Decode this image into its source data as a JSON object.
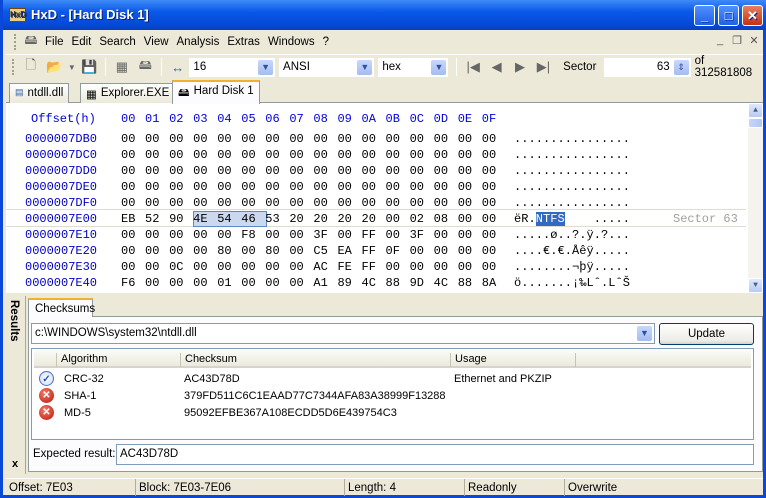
{
  "window": {
    "title": "HxD - [Hard Disk 1]"
  },
  "menu": [
    "File",
    "Edit",
    "Search",
    "View",
    "Analysis",
    "Extras",
    "Windows",
    "?"
  ],
  "toolbar": {
    "bytes_per_row": "16",
    "charset": "ANSI",
    "offset_base": "hex",
    "sector_label": "Sector",
    "sector_value": "63",
    "sector_total": "of 312581808"
  },
  "tabs": [
    {
      "label": "ntdll.dll",
      "icon": "dll-file-icon"
    },
    {
      "label": "Explorer.EXE",
      "icon": "memory-chip-icon"
    },
    {
      "label": "Hard Disk 1",
      "icon": "hard-disk-icon",
      "active": true
    }
  ],
  "hex": {
    "offset_header": "Offset(h)",
    "columns": [
      "00",
      "01",
      "02",
      "03",
      "04",
      "05",
      "06",
      "07",
      "08",
      "09",
      "0A",
      "0B",
      "0C",
      "0D",
      "0E",
      "0F"
    ],
    "rows": [
      {
        "offset": "0000007DB0",
        "bytes": [
          "00",
          "00",
          "00",
          "00",
          "00",
          "00",
          "00",
          "00",
          "00",
          "00",
          "00",
          "00",
          "00",
          "00",
          "00",
          "00"
        ],
        "text": "................"
      },
      {
        "offset": "0000007DC0",
        "bytes": [
          "00",
          "00",
          "00",
          "00",
          "00",
          "00",
          "00",
          "00",
          "00",
          "00",
          "00",
          "00",
          "00",
          "00",
          "00",
          "00"
        ],
        "text": "................"
      },
      {
        "offset": "0000007DD0",
        "bytes": [
          "00",
          "00",
          "00",
          "00",
          "00",
          "00",
          "00",
          "00",
          "00",
          "00",
          "00",
          "00",
          "00",
          "00",
          "00",
          "00"
        ],
        "text": "................"
      },
      {
        "offset": "0000007DE0",
        "bytes": [
          "00",
          "00",
          "00",
          "00",
          "00",
          "00",
          "00",
          "00",
          "00",
          "00",
          "00",
          "00",
          "00",
          "00",
          "00",
          "00"
        ],
        "text": "................"
      },
      {
        "offset": "0000007DF0",
        "bytes": [
          "00",
          "00",
          "00",
          "00",
          "00",
          "00",
          "00",
          "00",
          "00",
          "00",
          "00",
          "00",
          "00",
          "00",
          "00",
          "00"
        ],
        "text": "................"
      },
      {
        "offset": "0000007E00",
        "bytes": [
          "EB",
          "52",
          "90",
          "4E",
          "54",
          "46",
          "53",
          "20",
          "20",
          "20",
          "20",
          "00",
          "02",
          "08",
          "00",
          "00"
        ],
        "text_pre": "ëR.",
        "text_sel": "NTFS",
        "text_post": "    .....",
        "sector_marker": "Sector 63"
      },
      {
        "offset": "0000007E10",
        "bytes": [
          "00",
          "00",
          "00",
          "00",
          "00",
          "F8",
          "00",
          "00",
          "3F",
          "00",
          "FF",
          "00",
          "3F",
          "00",
          "00",
          "00"
        ],
        "text": ".....ø..?.ÿ.?..."
      },
      {
        "offset": "0000007E20",
        "bytes": [
          "00",
          "00",
          "00",
          "00",
          "80",
          "00",
          "80",
          "00",
          "C5",
          "EA",
          "FF",
          "0F",
          "00",
          "00",
          "00",
          "00"
        ],
        "text": "....€.€.Åêÿ....."
      },
      {
        "offset": "0000007E30",
        "bytes": [
          "00",
          "00",
          "0C",
          "00",
          "00",
          "00",
          "00",
          "00",
          "AC",
          "FE",
          "FF",
          "00",
          "00",
          "00",
          "00",
          "00"
        ],
        "text": "........¬þÿ....."
      },
      {
        "offset": "0000007E40",
        "bytes": [
          "F6",
          "00",
          "00",
          "00",
          "01",
          "00",
          "00",
          "00",
          "A1",
          "89",
          "4C",
          "88",
          "9D",
          "4C",
          "88",
          "8A"
        ],
        "text": "ö.......¡‰Lˆ.LˆŠ"
      }
    ]
  },
  "results": {
    "side_label": "Results",
    "close": "x",
    "tab": "Checksums",
    "file": "c:\\WINDOWS\\system32\\ntdll.dll",
    "update_label": "Update",
    "columns": [
      "Algorithm",
      "Checksum",
      "Usage"
    ],
    "rows": [
      {
        "status": "match",
        "algorithm": "CRC-32",
        "checksum": "AC43D78D",
        "usage": "Ethernet and PKZIP"
      },
      {
        "status": "mismatch",
        "algorithm": "SHA-1",
        "checksum": "379FD511C6C1EAAD77C7344AFA83A38999F13288",
        "usage": ""
      },
      {
        "status": "mismatch",
        "algorithm": "MD-5",
        "checksum": "95092EFBE367A108ECDD5D6E439754C3",
        "usage": ""
      }
    ],
    "expected_label": "Expected result:",
    "expected_value": "AC43D78D"
  },
  "status": {
    "offset": "Offset: 7E03",
    "block": "Block: 7E03-7E06",
    "length": "Length: 4",
    "mode": "Readonly",
    "insert": "Overwrite"
  },
  "colors": {
    "title_bar": "#0548d6",
    "offset_text": "#0000c0",
    "selection": "#316ac5"
  }
}
